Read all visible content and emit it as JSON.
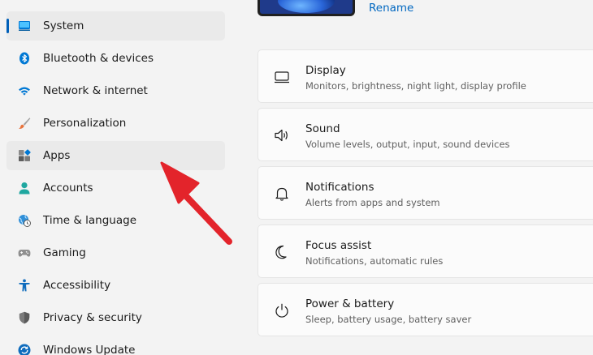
{
  "sidebar": {
    "items": [
      {
        "label": "System",
        "icon": "system-icon"
      },
      {
        "label": "Bluetooth & devices",
        "icon": "bluetooth-icon"
      },
      {
        "label": "Network & internet",
        "icon": "wifi-icon"
      },
      {
        "label": "Personalization",
        "icon": "brush-icon"
      },
      {
        "label": "Apps",
        "icon": "apps-icon"
      },
      {
        "label": "Accounts",
        "icon": "account-icon"
      },
      {
        "label": "Time & language",
        "icon": "globe-clock-icon"
      },
      {
        "label": "Gaming",
        "icon": "gamepad-icon"
      },
      {
        "label": "Accessibility",
        "icon": "accessibility-icon"
      },
      {
        "label": "Privacy & security",
        "icon": "shield-icon"
      },
      {
        "label": "Windows Update",
        "icon": "update-icon"
      }
    ],
    "selected": "System",
    "highlighted": "Apps"
  },
  "device": {
    "rename_label": "Rename"
  },
  "cards": [
    {
      "title": "Display",
      "subtitle": "Monitors, brightness, night light, display profile",
      "icon": "monitor-icon"
    },
    {
      "title": "Sound",
      "subtitle": "Volume levels, output, input, sound devices",
      "icon": "speaker-icon"
    },
    {
      "title": "Notifications",
      "subtitle": "Alerts from apps and system",
      "icon": "bell-icon"
    },
    {
      "title": "Focus assist",
      "subtitle": "Notifications, automatic rules",
      "icon": "moon-icon"
    },
    {
      "title": "Power & battery",
      "subtitle": "Sleep, battery usage, battery saver",
      "icon": "power-icon"
    }
  ],
  "colors": {
    "accent": "#005fb8",
    "link": "#0067c0",
    "annotation_arrow": "#e3242b"
  }
}
